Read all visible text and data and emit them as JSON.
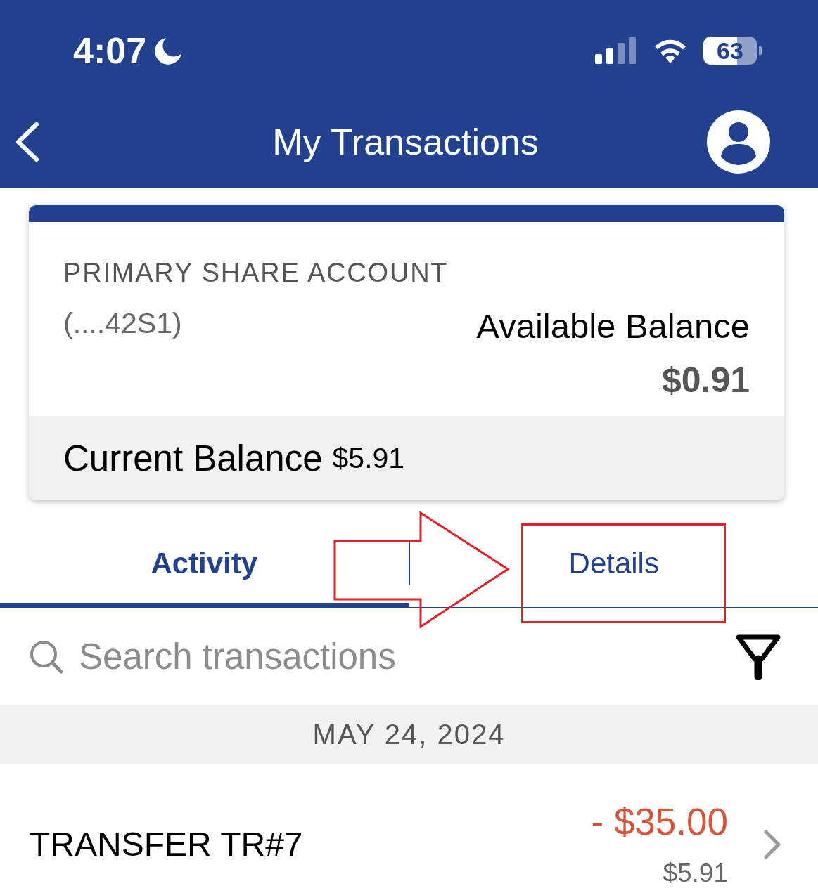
{
  "status_bar": {
    "time": "4:07",
    "battery": "63"
  },
  "header": {
    "title": "My Transactions"
  },
  "account": {
    "name": "PRIMARY SHARE ACCOUNT",
    "number": "(....42S1)",
    "available_label": "Available Balance",
    "available_amount": "$0.91",
    "current_label": "Current Balance",
    "current_amount": "$5.91"
  },
  "tabs": [
    {
      "label": "Activity",
      "selected": true
    },
    {
      "label": "Details",
      "selected": false
    }
  ],
  "search": {
    "placeholder": "Search transactions"
  },
  "groups": [
    {
      "date": "MAY 24, 2024",
      "transactions": [
        {
          "description": "TRANSFER TR#7",
          "kind": "debit",
          "amount": "- $35.00",
          "balance": "$5.91"
        }
      ]
    }
  ]
}
